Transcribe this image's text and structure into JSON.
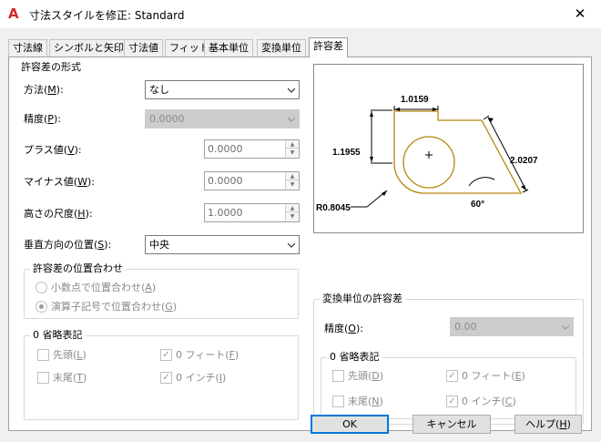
{
  "window": {
    "title": "寸法スタイルを修正: Standard",
    "app_icon": "autocad-a-icon",
    "close_glyph": "✕"
  },
  "tabs": [
    {
      "label": "寸法線",
      "active": false
    },
    {
      "label": "シンボルと矢印",
      "active": false
    },
    {
      "label": "寸法値",
      "active": false
    },
    {
      "label": "フィット",
      "active": false
    },
    {
      "label": "基本単位",
      "active": false
    },
    {
      "label": "変換単位",
      "active": false
    },
    {
      "label": "許容差",
      "active": true
    }
  ],
  "tolerance_format": {
    "title": "許容差の形式",
    "method": {
      "label": "方法(",
      "key": "M",
      "suffix": "):",
      "value": "なし"
    },
    "precision": {
      "label": "精度(",
      "key": "P",
      "suffix": "):",
      "value": "0.0000"
    },
    "plus": {
      "label": "プラス値(",
      "key": "V",
      "suffix": "):",
      "value": "0.0000"
    },
    "minus": {
      "label": "マイナス値(",
      "key": "W",
      "suffix": "):",
      "value": "0.0000"
    },
    "height": {
      "label": "高さの尺度(",
      "key": "H",
      "suffix": "):",
      "value": "1.0000"
    },
    "vpos": {
      "label": "垂直方向の位置(",
      "key": "S",
      "suffix": "):",
      "value": "中央"
    }
  },
  "alignment": {
    "title": "許容差の位置合わせ",
    "opt1": {
      "label": "小数点で位置合わせ(",
      "key": "A",
      "suffix": ")",
      "selected": false
    },
    "opt2": {
      "label": "演算子記号で位置合わせ(",
      "key": "G",
      "suffix": ")",
      "selected": true
    }
  },
  "zero_left": {
    "title": "0 省略表記",
    "leading": {
      "label": "先頭(",
      "key": "L",
      "suffix": ")",
      "checked": false
    },
    "trailing": {
      "label": "末尾(",
      "key": "T",
      "suffix": ")",
      "checked": false
    },
    "feet": {
      "label": "0 フィート(",
      "key": "F",
      "suffix": ")",
      "checked": true
    },
    "inches": {
      "label": "0 インチ(",
      "key": "I",
      "suffix": ")",
      "checked": true
    }
  },
  "preview": {
    "dim_top": "1.0159",
    "dim_left": "1.1955",
    "dim_right": "2.0207",
    "angle": "60°",
    "radius": "R0.8045"
  },
  "alt_tolerance": {
    "title": "変換単位の許容差",
    "precision": {
      "label": "精度(",
      "key": "O",
      "suffix": "):",
      "value": "0.00"
    }
  },
  "zero_right": {
    "title": "0 省略表記",
    "leading": {
      "label": "先頭(",
      "key": "D",
      "suffix": ")",
      "checked": false
    },
    "trailing": {
      "label": "末尾(",
      "key": "N",
      "suffix": ")",
      "checked": false
    },
    "feet": {
      "label": "0 フィート(",
      "key": "E",
      "suffix": ")",
      "checked": true
    },
    "inches": {
      "label": "0 インチ(",
      "key": "C",
      "suffix": ")",
      "checked": true
    }
  },
  "buttons": {
    "ok": "OK",
    "cancel": "キャンセル",
    "help": {
      "label": "ヘルプ(",
      "key": "H",
      "suffix": ")"
    }
  },
  "colors": {
    "accent": "#0078d7",
    "preview_outline": "#b8860b",
    "preview_dim": "#000000"
  }
}
